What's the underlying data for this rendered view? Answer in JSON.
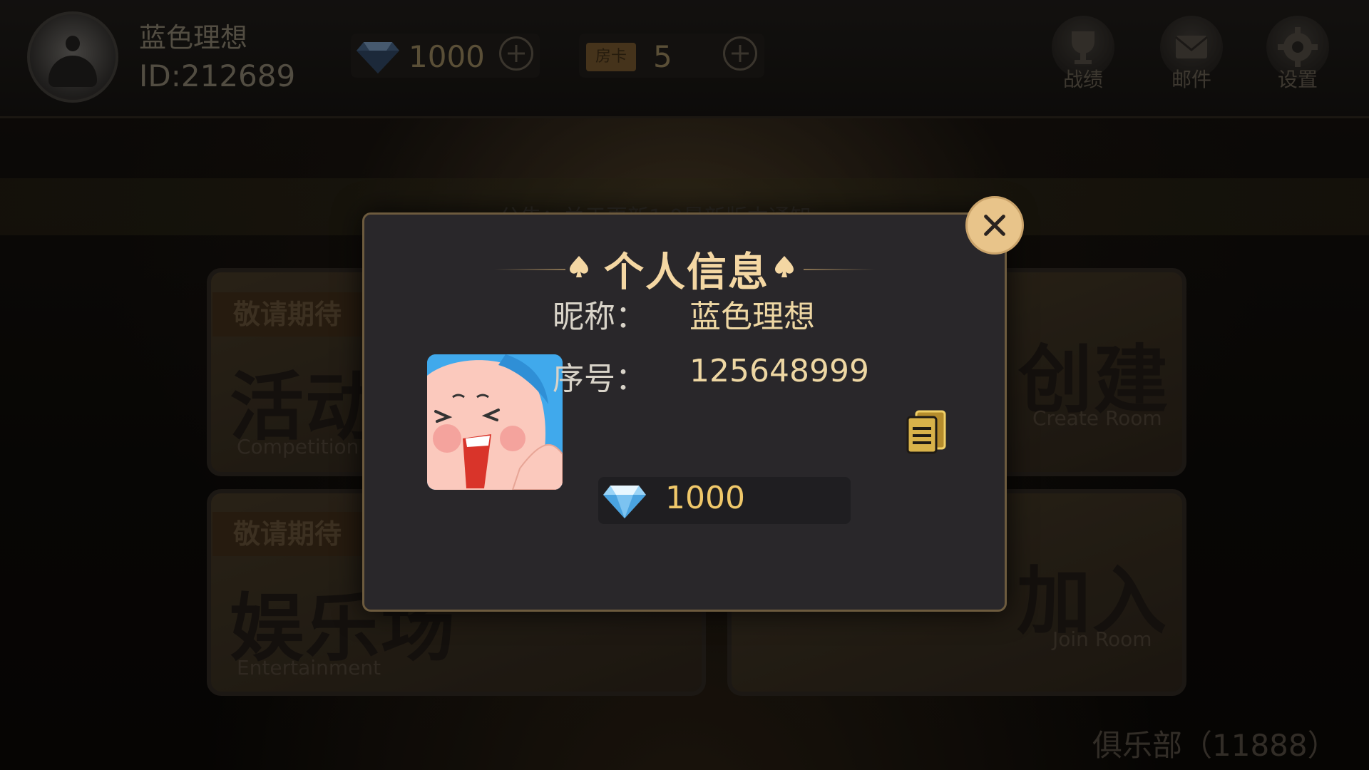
{
  "header": {
    "nickname": "蓝色理想",
    "id_text": "ID:212689",
    "diamonds": "1000",
    "room_card_label": "房卡",
    "room_cards": "5",
    "buttons": [
      {
        "label": "战绩",
        "icon": "trophy-icon"
      },
      {
        "label": "邮件",
        "icon": "mail-icon"
      },
      {
        "label": "设置",
        "icon": "gear-icon"
      }
    ]
  },
  "notice": "公告：关于更新1.0最新版本通知",
  "menu": {
    "activity": {
      "tag": "敬请期待",
      "title": "活动",
      "subtitle": "Competition"
    },
    "entertainment": {
      "tag": "敬请期待",
      "title": "娱乐场",
      "subtitle": "Entertainment"
    },
    "create": {
      "title": "创建",
      "subtitle": "Create Room"
    },
    "join": {
      "title": "加入",
      "subtitle": "Join Room"
    }
  },
  "club": "俱乐部（11888）",
  "dialog": {
    "title": "个人信息",
    "nickname_label": "昵称：",
    "nickname_value": "蓝色理想",
    "serial_label": "序号：",
    "serial_value": "125648999",
    "diamonds": "1000"
  },
  "colors": {
    "accent_gold": "#f4d7a3",
    "dialog_bg": "#29272a",
    "close_button": "#e8c48a",
    "diamond_text": "#f0c86a"
  }
}
